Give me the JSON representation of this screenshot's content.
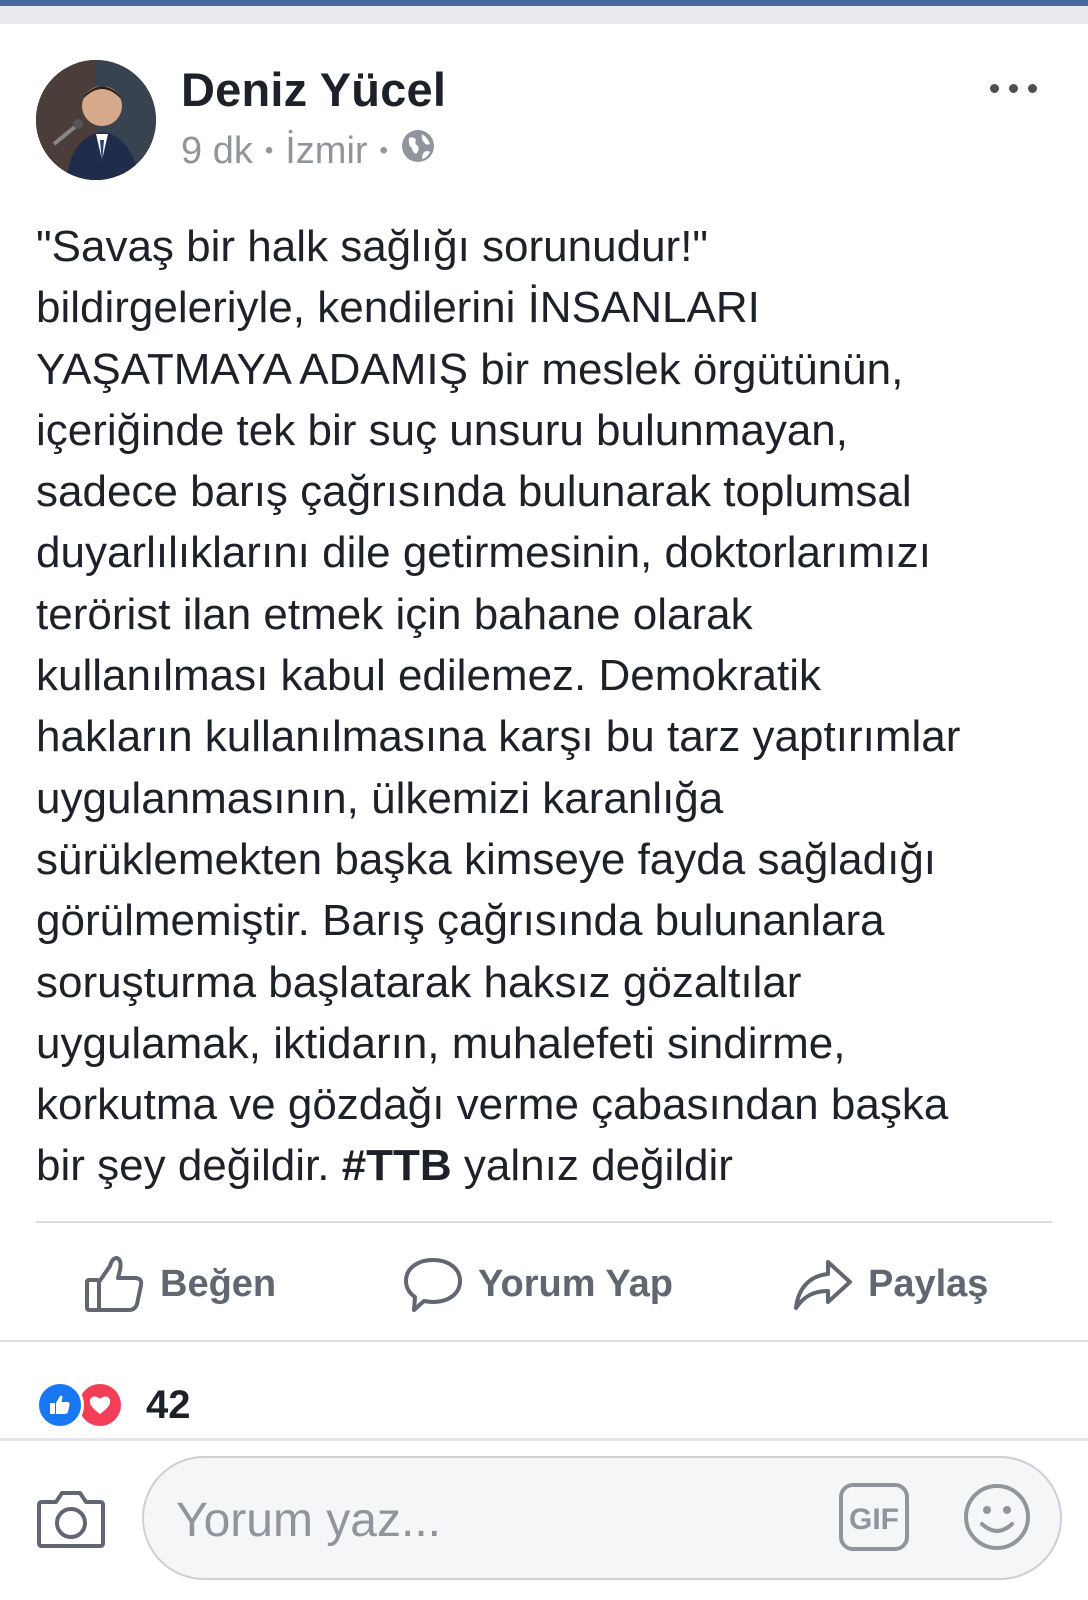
{
  "post": {
    "author": "Deniz Yücel",
    "time": "9 dk",
    "location": "İzmir",
    "privacy_icon": "globe-icon",
    "text_lines": [
      "\"Savaş bir halk sağlığı sorunudur!\"",
      "bildirgeleriyle, kendilerini İNSANLARI",
      "YAŞATMAYA ADAMIŞ bir meslek örgütünün,",
      "içeriğinde tek bir suç unsuru bulunmayan,",
      "sadece barış çağrısında bulunarak toplumsal",
      "duyarlılıklarını dile getirmesinin, doktorlarımızı",
      "terörist ilan etmek için bahane olarak",
      "kullanılması kabul edilemez. Demokratik",
      "hakların kullanılmasına karşı bu tarz yaptırımlar",
      "uygulanmasının, ülkemizi karanlığa",
      "sürüklemekten başka kimseye fayda sağladığı",
      "görülmemiştir. Barış çağrısında bulunanlara",
      "soruşturma başlatarak haksız gözaltılar",
      "uygulamak, iktidarın, muhalefeti sindirme,",
      "korkutma ve gözdağı verme çabasından başka"
    ],
    "last_line_prefix": "bir şey değildir. ",
    "hashtag": "#TTB",
    "last_line_suffix": " yalnız değildir"
  },
  "actions": {
    "like": "Beğen",
    "comment": "Yorum Yap",
    "share": "Paylaş"
  },
  "reactions": {
    "count": "42",
    "icons": [
      "like-reaction-icon",
      "love-reaction-icon"
    ]
  },
  "composer": {
    "placeholder": "Yorum yaz...",
    "gif_label": "GIF"
  },
  "colors": {
    "accent": "#4b67a1",
    "text": "#1d2129",
    "secondary": "#90949c",
    "like_blue": "#1877f2",
    "love_red": "#f33e58"
  }
}
